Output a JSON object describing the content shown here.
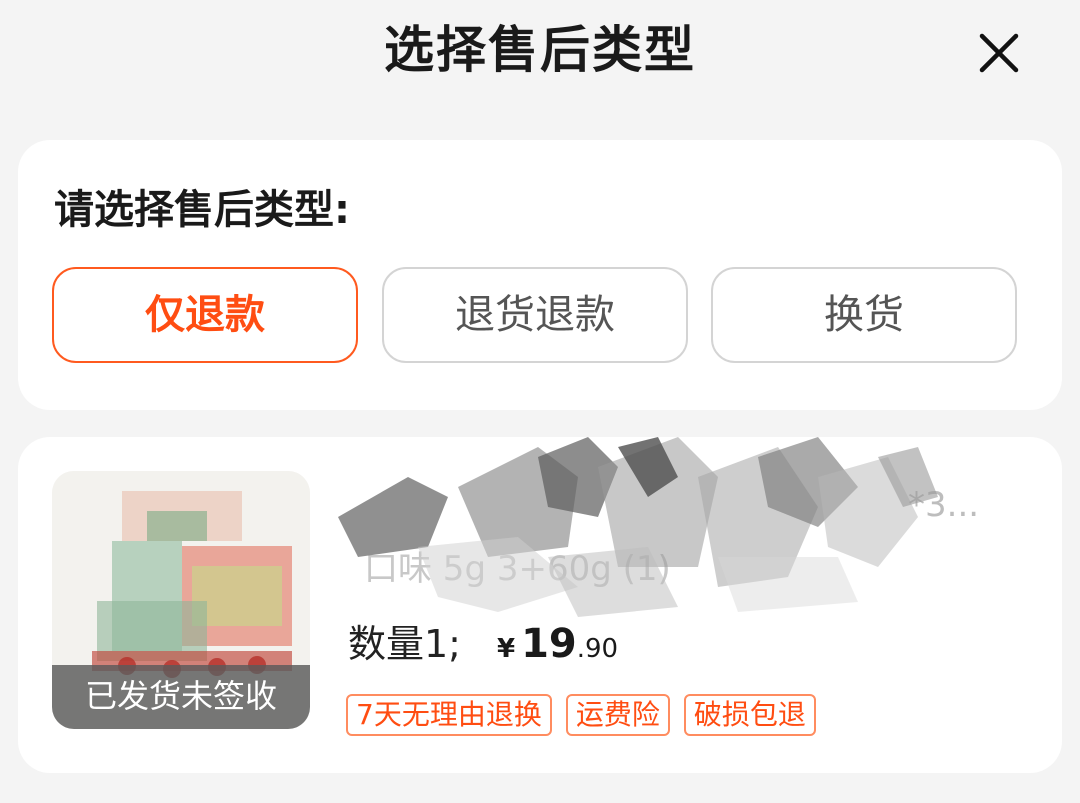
{
  "header": {
    "title": "选择售后类型"
  },
  "type_section": {
    "label": "请选择售后类型:",
    "options": [
      {
        "label": "仅退款",
        "selected": true
      },
      {
        "label": "退货退款",
        "selected": false
      },
      {
        "label": "换货",
        "selected": false
      }
    ]
  },
  "product": {
    "name": "*3...",
    "spec": "口味 5g 3+60g (1)",
    "quantity": "数量1;",
    "price": {
      "symbol": "¥",
      "integer": "19",
      "decimal": ".90"
    },
    "status": "已发货未签收",
    "tags": [
      "7天无理由退换",
      "运费险",
      "破损包退"
    ]
  },
  "colors": {
    "accent": "#ff4d12",
    "background": "#f4f4f4"
  }
}
